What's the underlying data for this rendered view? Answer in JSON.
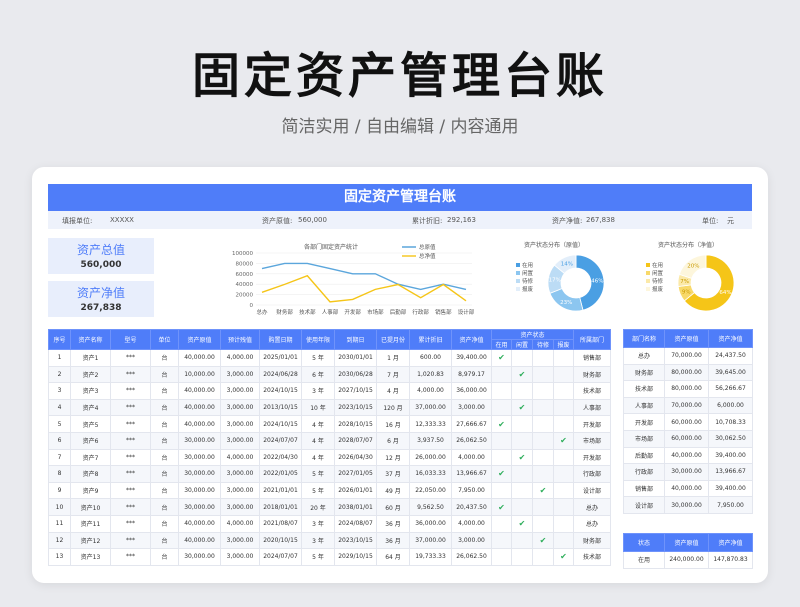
{
  "page": {
    "title": "固定资产管理台账",
    "subtitle": "简洁实用 / 自由编辑 / 内容通用"
  },
  "sheet": {
    "title": "固定资产管理台账",
    "info": {
      "unit_label": "填报单位:",
      "unit_value": "XXXXX",
      "orig_label": "资产原值:",
      "orig_value": "560,000",
      "dep_label": "累计折旧:",
      "dep_value": "292,163",
      "net_label": "资产净值:",
      "net_value": "267,838",
      "currency_label": "单位:",
      "currency_value": "元"
    },
    "summary": [
      {
        "label": "资产总值",
        "value": "560,000"
      },
      {
        "label": "资产净值",
        "value": "267,838"
      }
    ]
  },
  "colors": {
    "accent": "#4f7df9",
    "line_orig": "#5ba6dc",
    "line_net": "#f5c518",
    "check": "#2fae5c"
  },
  "chart_data": [
    {
      "type": "line",
      "title": "各部门固定资产统计",
      "categories": [
        "总办",
        "财务部",
        "技术部",
        "人事部",
        "开发部",
        "市场部",
        "后勤部",
        "行政部",
        "销售部",
        "设计部"
      ],
      "series": [
        {
          "name": "总原值",
          "values": [
            70000,
            80000,
            80000,
            70000,
            60000,
            60000,
            40000,
            30000,
            40000,
            30000
          ]
        },
        {
          "name": "总净值",
          "values": [
            24438,
            39645,
            56267,
            6000,
            10708,
            30062,
            39400,
            13967,
            39400,
            7950
          ]
        }
      ],
      "ylim": [
        0,
        100000
      ],
      "yticks": [
        "100000",
        "80000",
        "60000",
        "40000",
        "20000",
        "0"
      ],
      "legend": "top-right"
    },
    {
      "type": "pie",
      "title": "资产状态分布（原值）",
      "categories": [
        "在用",
        "闲置",
        "待修",
        "报废"
      ],
      "values": [
        46,
        23,
        17,
        14
      ],
      "labels": [
        "46%",
        "23%",
        "17%",
        "14%"
      ],
      "legend": "left"
    },
    {
      "type": "pie",
      "title": "资产状态分布（净值）",
      "categories": [
        "在用",
        "闲置",
        "待修",
        "报废"
      ],
      "values": [
        64,
        9,
        7,
        20
      ],
      "labels": [
        "64%",
        "9%",
        "7%",
        "20%"
      ],
      "legend": "left"
    }
  ],
  "main_table": {
    "headers": [
      "序号",
      "资产名称",
      "型号",
      "单位",
      "资产原值",
      "预计残值",
      "购置日期",
      "使用年限",
      "到期日",
      "已提月份",
      "累计折旧",
      "资产净值",
      "资产状态",
      "所属部门"
    ],
    "status_headers": [
      "在用",
      "闲置",
      "待修",
      "报废"
    ],
    "rows": [
      [
        "1",
        "资产1",
        "***",
        "台",
        "40,000.00",
        "4,000.00",
        "2025/01/01",
        "5 年",
        "2030/01/01",
        "1 月",
        "600.00",
        "39,400.00",
        0,
        "销售部"
      ],
      [
        "2",
        "资产2",
        "***",
        "台",
        "10,000.00",
        "3,000.00",
        "2024/06/28",
        "6 年",
        "2030/06/28",
        "7 月",
        "1,020.83",
        "8,979.17",
        1,
        "财务部"
      ],
      [
        "3",
        "资产3",
        "***",
        "台",
        "40,000.00",
        "3,000.00",
        "2024/10/15",
        "3 年",
        "2027/10/15",
        "4 月",
        "4,000.00",
        "36,000.00",
        -1,
        "技术部"
      ],
      [
        "4",
        "资产4",
        "***",
        "台",
        "40,000.00",
        "3,000.00",
        "2013/10/15",
        "10 年",
        "2023/10/15",
        "120 月",
        "37,000.00",
        "3,000.00",
        1,
        "人事部"
      ],
      [
        "5",
        "资产5",
        "***",
        "台",
        "40,000.00",
        "3,000.00",
        "2024/10/15",
        "4 年",
        "2028/10/15",
        "16 月",
        "12,333.33",
        "27,666.67",
        0,
        "开发部"
      ],
      [
        "6",
        "资产6",
        "***",
        "台",
        "30,000.00",
        "3,000.00",
        "2024/07/07",
        "4 年",
        "2028/07/07",
        "6 月",
        "3,937.50",
        "26,062.50",
        3,
        "市场部"
      ],
      [
        "7",
        "资产7",
        "***",
        "台",
        "30,000.00",
        "4,000.00",
        "2022/04/30",
        "4 年",
        "2026/04/30",
        "12 月",
        "26,000.00",
        "4,000.00",
        1,
        "开发部"
      ],
      [
        "8",
        "资产8",
        "***",
        "台",
        "30,000.00",
        "3,000.00",
        "2022/01/05",
        "5 年",
        "2027/01/05",
        "37 月",
        "16,033.33",
        "13,966.67",
        0,
        "行政部"
      ],
      [
        "9",
        "资产9",
        "***",
        "台",
        "30,000.00",
        "3,000.00",
        "2021/01/01",
        "5 年",
        "2026/01/01",
        "49 月",
        "22,050.00",
        "7,950.00",
        2,
        "设计部"
      ],
      [
        "10",
        "资产10",
        "***",
        "台",
        "30,000.00",
        "3,000.00",
        "2018/01/01",
        "20 年",
        "2038/01/01",
        "60 月",
        "9,562.50",
        "20,437.50",
        0,
        "总办"
      ],
      [
        "11",
        "资产11",
        "***",
        "台",
        "40,000.00",
        "4,000.00",
        "2021/08/07",
        "3 年",
        "2024/08/07",
        "36 月",
        "36,000.00",
        "4,000.00",
        1,
        "总办"
      ],
      [
        "12",
        "资产12",
        "***",
        "台",
        "40,000.00",
        "3,000.00",
        "2020/10/15",
        "3 年",
        "2023/10/15",
        "36 月",
        "37,000.00",
        "3,000.00",
        2,
        "财务部"
      ],
      [
        "13",
        "资产13",
        "***",
        "台",
        "30,000.00",
        "3,000.00",
        "2024/07/07",
        "5 年",
        "2029/10/15",
        "64 月",
        "19,733.33",
        "26,062.50",
        3,
        "技术部"
      ]
    ]
  },
  "dept_table": {
    "headers": [
      "部门名称",
      "资产原值",
      "资产净值"
    ],
    "rows": [
      [
        "总办",
        "70,000.00",
        "24,437.50"
      ],
      [
        "财务部",
        "80,000.00",
        "39,645.00"
      ],
      [
        "技术部",
        "80,000.00",
        "56,266.67"
      ],
      [
        "人事部",
        "70,000.00",
        "6,000.00"
      ],
      [
        "开发部",
        "60,000.00",
        "10,708.33"
      ],
      [
        "市场部",
        "60,000.00",
        "30,062.50"
      ],
      [
        "后勤部",
        "40,000.00",
        "39,400.00"
      ],
      [
        "行政部",
        "30,000.00",
        "13,966.67"
      ],
      [
        "销售部",
        "40,000.00",
        "39,400.00"
      ],
      [
        "设计部",
        "30,000.00",
        "7,950.00"
      ]
    ]
  },
  "status_table": {
    "headers": [
      "状态",
      "资产原值",
      "资产净值"
    ],
    "rows": [
      [
        "在用",
        "240,000.00",
        "147,870.83"
      ]
    ]
  }
}
